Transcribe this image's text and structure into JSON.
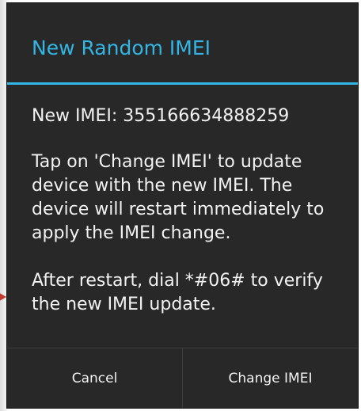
{
  "dialog": {
    "title": "New Random IMEI",
    "imei_line": "New IMEI: 355166634888259",
    "instruction": "Tap on 'Change IMEI' to update device with the new IMEI. The device will restart immediately to apply the IMEI change.",
    "verify_note": "After restart, dial *#06# to verify the new IMEI update.",
    "buttons": {
      "cancel_label": "Cancel",
      "change_label": "Change IMEI"
    }
  },
  "colors": {
    "accent": "#33b5e5",
    "dialog_background": "#282828",
    "text": "#f2f2f2",
    "pointer_arrow": "#c0392b"
  },
  "icons": {
    "pointer": "arrow-right-icon"
  }
}
